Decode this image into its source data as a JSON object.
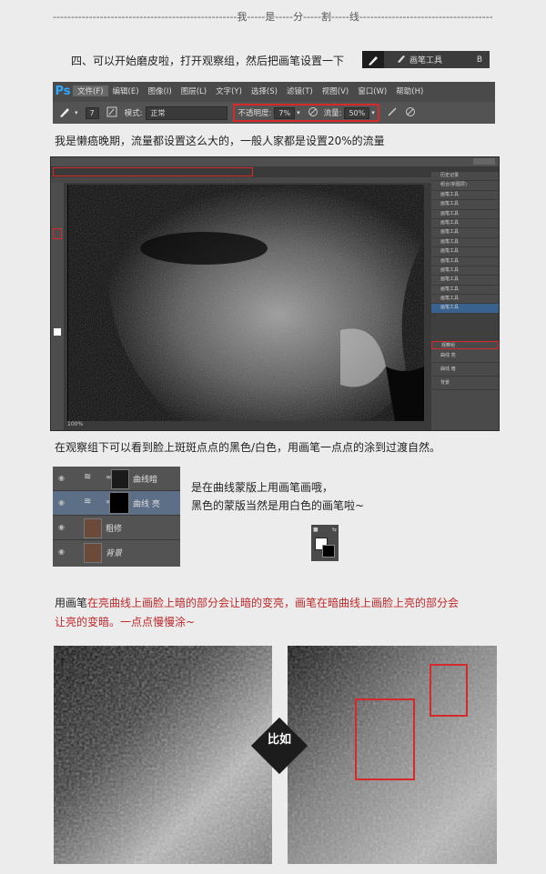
{
  "divider_text": "---------------------------------------------------我-----是-----分-----割-----线--------------------------------------------------",
  "step4": {
    "text": "四、可以开始磨皮啦，打开观察组，然后把画笔设置一下",
    "badge_label": "画笔工具",
    "badge_key": "B"
  },
  "ps": {
    "logo": "Ps",
    "menu": [
      "文件(F)",
      "编辑(E)",
      "图像(I)",
      "图层(L)",
      "文字(Y)",
      "选择(S)",
      "滤镜(T)",
      "视图(V)",
      "窗口(W)",
      "帮助(H)"
    ],
    "brush_size": "7",
    "mode_label": "模式:",
    "mode_value": "正常",
    "opacity_label": "不透明度:",
    "opacity_value": "7%",
    "flow_label": "流量:",
    "flow_value": "50%"
  },
  "para1": "我是懒癌晚期，流量都设置这么大的，一般人家都是设置20%的流量",
  "screenshot": {
    "zoom": "100%",
    "panel_items": [
      "历史记录",
      "组合(新图层)",
      "画笔工具",
      "画笔工具",
      "画笔工具",
      "画笔工具",
      "画笔工具",
      "画笔工具",
      "画笔工具",
      "画笔工具",
      "画笔工具",
      "画笔工具",
      "画笔工具",
      "画笔工具",
      "画笔工具"
    ],
    "layer_rows": [
      "观察组",
      "曲线 亮",
      "曲线 暗",
      "背景"
    ]
  },
  "para2": "在观察组下可以看到脸上斑斑点点的黑色/白色，用画笔一点点的涂到过渡自然。",
  "layers": [
    {
      "name": "曲线暗"
    },
    {
      "name": "曲线 亮"
    },
    {
      "name": "粗修"
    },
    {
      "name": "背景"
    }
  ],
  "note": {
    "line1": "是在曲线蒙版上用画笔画哦，",
    "line2": "黑色的蒙版当然是用白色的画笔啦~"
  },
  "para3": {
    "prefix": "用画笔",
    "red1": "在亮曲线上画脸上暗的部分会让暗的变亮，画笔在暗曲线上画脸上亮的部分会",
    "red2": "让亮的变暗。一点点慢慢涂~"
  },
  "compare_label": "比如",
  "colors": {
    "accent_red": "#c0282a",
    "box_red": "#d62a2a",
    "ps_blue": "#31a8ff"
  }
}
